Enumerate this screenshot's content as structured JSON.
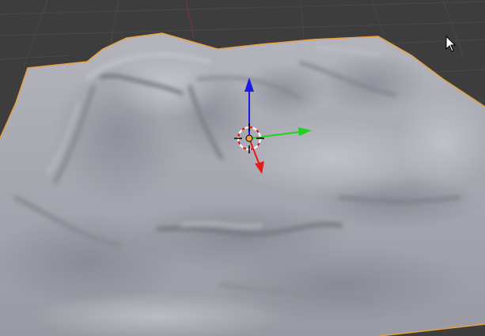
{
  "viewport": {
    "background_color": "#3d3d3d",
    "grid_color": "#484848",
    "x_axis_line_color": "#7a3838",
    "mesh_color": "#a8a8b2",
    "mesh_shadow_color": "#6e6e78",
    "mesh_highlight_color": "#c8c8d0",
    "selection_outline_color": "#e8a040"
  },
  "gizmo": {
    "type": "translate-manipulator",
    "z_axis_color": "#1a1ae6",
    "y_axis_color": "#1ed41e",
    "x_axis_color": "#e61a1a",
    "center_color": "#e8a040"
  },
  "cursor": {
    "icon": "mouse-pointer-icon",
    "color": "#ffffff"
  },
  "object": {
    "name_icon": "terrain-mesh",
    "selected": true
  }
}
